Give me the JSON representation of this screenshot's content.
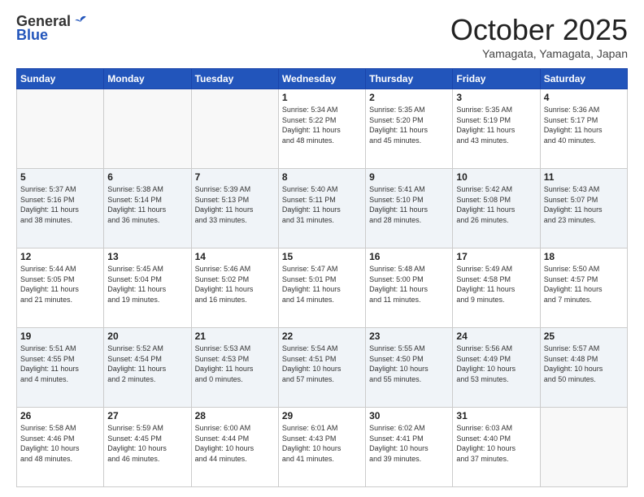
{
  "logo": {
    "general": "General",
    "blue": "Blue"
  },
  "header": {
    "month": "October 2025",
    "location": "Yamagata, Yamagata, Japan"
  },
  "weekdays": [
    "Sunday",
    "Monday",
    "Tuesday",
    "Wednesday",
    "Thursday",
    "Friday",
    "Saturday"
  ],
  "weeks": [
    [
      {
        "day": "",
        "info": ""
      },
      {
        "day": "",
        "info": ""
      },
      {
        "day": "",
        "info": ""
      },
      {
        "day": "1",
        "info": "Sunrise: 5:34 AM\nSunset: 5:22 PM\nDaylight: 11 hours\nand 48 minutes."
      },
      {
        "day": "2",
        "info": "Sunrise: 5:35 AM\nSunset: 5:20 PM\nDaylight: 11 hours\nand 45 minutes."
      },
      {
        "day": "3",
        "info": "Sunrise: 5:35 AM\nSunset: 5:19 PM\nDaylight: 11 hours\nand 43 minutes."
      },
      {
        "day": "4",
        "info": "Sunrise: 5:36 AM\nSunset: 5:17 PM\nDaylight: 11 hours\nand 40 minutes."
      }
    ],
    [
      {
        "day": "5",
        "info": "Sunrise: 5:37 AM\nSunset: 5:16 PM\nDaylight: 11 hours\nand 38 minutes."
      },
      {
        "day": "6",
        "info": "Sunrise: 5:38 AM\nSunset: 5:14 PM\nDaylight: 11 hours\nand 36 minutes."
      },
      {
        "day": "7",
        "info": "Sunrise: 5:39 AM\nSunset: 5:13 PM\nDaylight: 11 hours\nand 33 minutes."
      },
      {
        "day": "8",
        "info": "Sunrise: 5:40 AM\nSunset: 5:11 PM\nDaylight: 11 hours\nand 31 minutes."
      },
      {
        "day": "9",
        "info": "Sunrise: 5:41 AM\nSunset: 5:10 PM\nDaylight: 11 hours\nand 28 minutes."
      },
      {
        "day": "10",
        "info": "Sunrise: 5:42 AM\nSunset: 5:08 PM\nDaylight: 11 hours\nand 26 minutes."
      },
      {
        "day": "11",
        "info": "Sunrise: 5:43 AM\nSunset: 5:07 PM\nDaylight: 11 hours\nand 23 minutes."
      }
    ],
    [
      {
        "day": "12",
        "info": "Sunrise: 5:44 AM\nSunset: 5:05 PM\nDaylight: 11 hours\nand 21 minutes."
      },
      {
        "day": "13",
        "info": "Sunrise: 5:45 AM\nSunset: 5:04 PM\nDaylight: 11 hours\nand 19 minutes."
      },
      {
        "day": "14",
        "info": "Sunrise: 5:46 AM\nSunset: 5:02 PM\nDaylight: 11 hours\nand 16 minutes."
      },
      {
        "day": "15",
        "info": "Sunrise: 5:47 AM\nSunset: 5:01 PM\nDaylight: 11 hours\nand 14 minutes."
      },
      {
        "day": "16",
        "info": "Sunrise: 5:48 AM\nSunset: 5:00 PM\nDaylight: 11 hours\nand 11 minutes."
      },
      {
        "day": "17",
        "info": "Sunrise: 5:49 AM\nSunset: 4:58 PM\nDaylight: 11 hours\nand 9 minutes."
      },
      {
        "day": "18",
        "info": "Sunrise: 5:50 AM\nSunset: 4:57 PM\nDaylight: 11 hours\nand 7 minutes."
      }
    ],
    [
      {
        "day": "19",
        "info": "Sunrise: 5:51 AM\nSunset: 4:55 PM\nDaylight: 11 hours\nand 4 minutes."
      },
      {
        "day": "20",
        "info": "Sunrise: 5:52 AM\nSunset: 4:54 PM\nDaylight: 11 hours\nand 2 minutes."
      },
      {
        "day": "21",
        "info": "Sunrise: 5:53 AM\nSunset: 4:53 PM\nDaylight: 11 hours\nand 0 minutes."
      },
      {
        "day": "22",
        "info": "Sunrise: 5:54 AM\nSunset: 4:51 PM\nDaylight: 10 hours\nand 57 minutes."
      },
      {
        "day": "23",
        "info": "Sunrise: 5:55 AM\nSunset: 4:50 PM\nDaylight: 10 hours\nand 55 minutes."
      },
      {
        "day": "24",
        "info": "Sunrise: 5:56 AM\nSunset: 4:49 PM\nDaylight: 10 hours\nand 53 minutes."
      },
      {
        "day": "25",
        "info": "Sunrise: 5:57 AM\nSunset: 4:48 PM\nDaylight: 10 hours\nand 50 minutes."
      }
    ],
    [
      {
        "day": "26",
        "info": "Sunrise: 5:58 AM\nSunset: 4:46 PM\nDaylight: 10 hours\nand 48 minutes."
      },
      {
        "day": "27",
        "info": "Sunrise: 5:59 AM\nSunset: 4:45 PM\nDaylight: 10 hours\nand 46 minutes."
      },
      {
        "day": "28",
        "info": "Sunrise: 6:00 AM\nSunset: 4:44 PM\nDaylight: 10 hours\nand 44 minutes."
      },
      {
        "day": "29",
        "info": "Sunrise: 6:01 AM\nSunset: 4:43 PM\nDaylight: 10 hours\nand 41 minutes."
      },
      {
        "day": "30",
        "info": "Sunrise: 6:02 AM\nSunset: 4:41 PM\nDaylight: 10 hours\nand 39 minutes."
      },
      {
        "day": "31",
        "info": "Sunrise: 6:03 AM\nSunset: 4:40 PM\nDaylight: 10 hours\nand 37 minutes."
      },
      {
        "day": "",
        "info": ""
      }
    ]
  ]
}
